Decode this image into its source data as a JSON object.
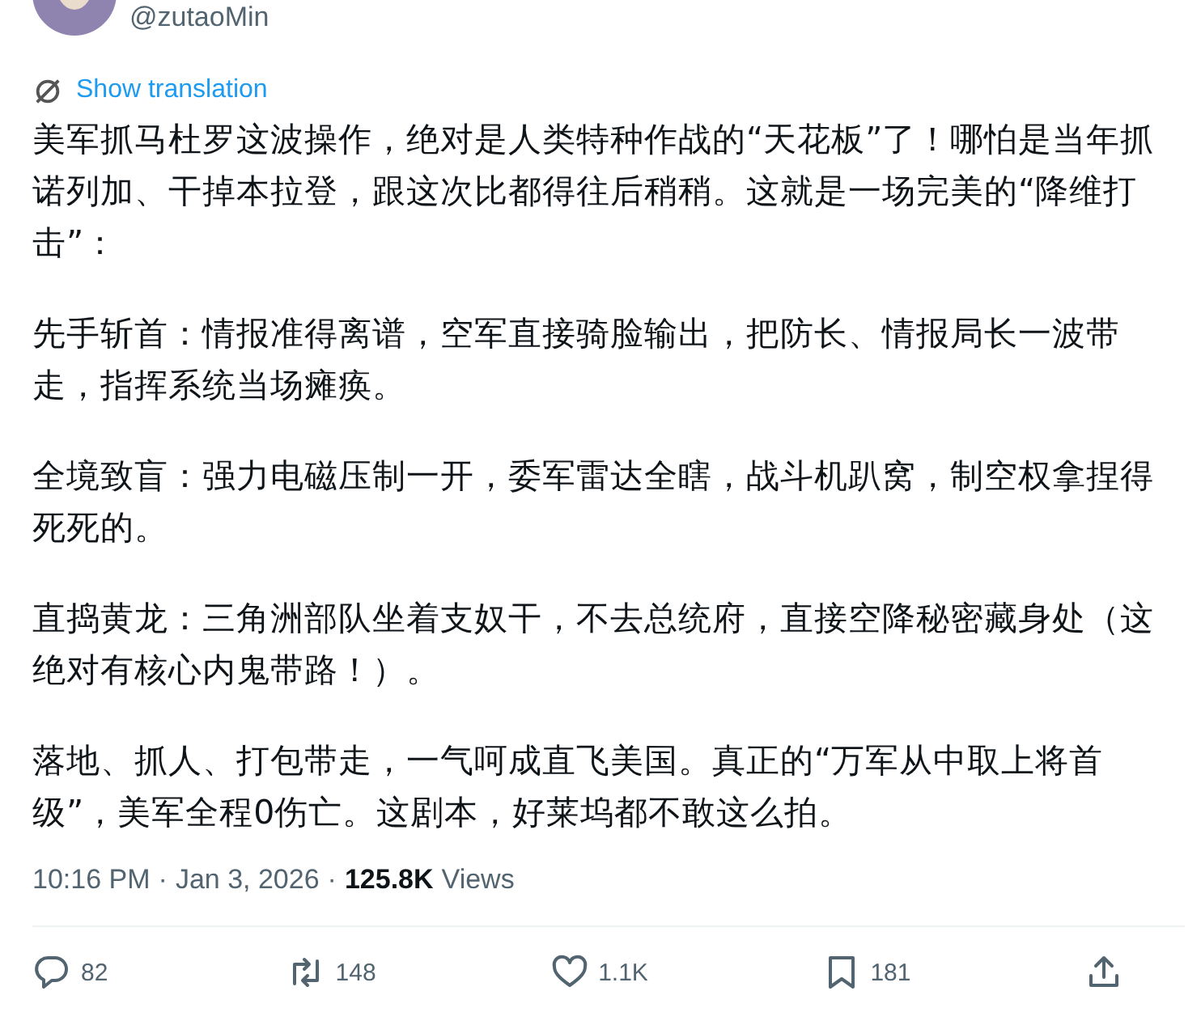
{
  "author": {
    "handle": "@zutaoMin"
  },
  "translation_link": "Show translation",
  "paragraphs": [
    "美军抓马杜罗这波操作，绝对是人类特种作战的“天花板”了！哪怕是当年抓诺列加、干掉本拉登，跟这次比都得往后稍稍。这就是一场完美的“降维打击”：",
    "先手斩首：情报准得离谱，空军直接骑脸输出，把防长、情报局长一波带走，指挥系统当场瘫痪。",
    "全境致盲：强力电磁压制一开，委军雷达全瞎，战斗机趴窝，制空权拿捏得死死的。",
    "直捣黄龙：三角洲部队坐着支奴干，不去总统府，直接空降秘密藏身处（这绝对有核心内鬼带路！）。",
    "落地、抓人、打包带走，一气呵成直飞美国。真正的“万军从中取上将首级”，美军全程0伤亡。这剧本，好莱坞都不敢这么拍。"
  ],
  "meta": {
    "separator": "·",
    "time": "10:16 PM",
    "date": "Jan 3, 2026",
    "views_count": "125.8K",
    "views_label": "Views"
  },
  "actions": [
    {
      "kind": "reply",
      "count": "82"
    },
    {
      "kind": "repost",
      "count": "148"
    },
    {
      "kind": "like",
      "count": "1.1K"
    },
    {
      "kind": "bookmark",
      "count": "181"
    },
    {
      "kind": "share"
    }
  ]
}
